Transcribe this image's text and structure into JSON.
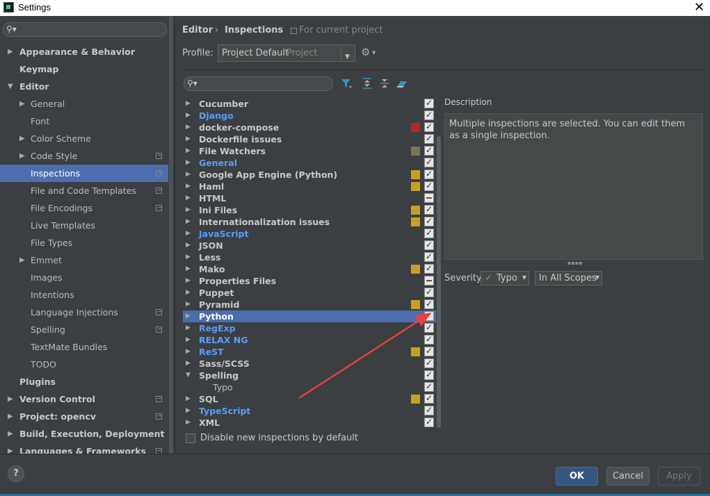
{
  "window": {
    "title": "Settings"
  },
  "left_tree": {
    "items": [
      {
        "label": "Appearance & Behavior",
        "bold": true,
        "arrow": "right",
        "indent": 0
      },
      {
        "label": "Keymap",
        "bold": true,
        "arrow": "",
        "indent": 0
      },
      {
        "label": "Editor",
        "bold": true,
        "arrow": "down",
        "indent": 0
      },
      {
        "label": "General",
        "bold": false,
        "arrow": "right",
        "indent": 1
      },
      {
        "label": "Font",
        "bold": false,
        "arrow": "",
        "indent": 1
      },
      {
        "label": "Color Scheme",
        "bold": false,
        "arrow": "right",
        "indent": 1
      },
      {
        "label": "Code Style",
        "bold": false,
        "arrow": "right",
        "indent": 1,
        "project": true
      },
      {
        "label": "Inspections",
        "bold": false,
        "arrow": "",
        "indent": 1,
        "project": true,
        "selected": true
      },
      {
        "label": "File and Code Templates",
        "bold": false,
        "arrow": "",
        "indent": 1,
        "project": true
      },
      {
        "label": "File Encodings",
        "bold": false,
        "arrow": "",
        "indent": 1,
        "project": true
      },
      {
        "label": "Live Templates",
        "bold": false,
        "arrow": "",
        "indent": 1
      },
      {
        "label": "File Types",
        "bold": false,
        "arrow": "",
        "indent": 1
      },
      {
        "label": "Emmet",
        "bold": false,
        "arrow": "right",
        "indent": 1
      },
      {
        "label": "Images",
        "bold": false,
        "arrow": "",
        "indent": 1
      },
      {
        "label": "Intentions",
        "bold": false,
        "arrow": "",
        "indent": 1
      },
      {
        "label": "Language Injections",
        "bold": false,
        "arrow": "",
        "indent": 1,
        "project": true
      },
      {
        "label": "Spelling",
        "bold": false,
        "arrow": "",
        "indent": 1,
        "project": true
      },
      {
        "label": "TextMate Bundles",
        "bold": false,
        "arrow": "",
        "indent": 1
      },
      {
        "label": "TODO",
        "bold": false,
        "arrow": "",
        "indent": 1
      },
      {
        "label": "Plugins",
        "bold": true,
        "arrow": "",
        "indent": 0
      },
      {
        "label": "Version Control",
        "bold": true,
        "arrow": "right",
        "indent": 0,
        "project": true
      },
      {
        "label": "Project: opencv",
        "bold": true,
        "arrow": "right",
        "indent": 0,
        "project": true
      },
      {
        "label": "Build, Execution, Deployment",
        "bold": true,
        "arrow": "right",
        "indent": 0
      },
      {
        "label": "Languages & Frameworks",
        "bold": true,
        "arrow": "right",
        "indent": 0,
        "project": true
      }
    ]
  },
  "breadcrumb": {
    "part1": "Editor",
    "separator": "›",
    "part2": "Inspections",
    "scope_note": "For current project"
  },
  "profile": {
    "label": "Profile:",
    "value": "Project Default",
    "type": "Project"
  },
  "inspections": [
    {
      "label": "Cucumber",
      "color": "",
      "sev": "",
      "check": "on"
    },
    {
      "label": "Django",
      "color": "blue",
      "sev": "",
      "check": "on"
    },
    {
      "label": "docker-compose",
      "color": "",
      "sev": "#b52626",
      "check": "on"
    },
    {
      "label": "Dockerfile issues",
      "color": "",
      "sev": "",
      "check": "on"
    },
    {
      "label": "File Watchers",
      "color": "",
      "sev": "#7b7560",
      "check": "on"
    },
    {
      "label": "General",
      "color": "blue",
      "sev": "",
      "check": "on"
    },
    {
      "label": "Google App Engine (Python)",
      "color": "",
      "sev": "#c9a01e",
      "check": "on"
    },
    {
      "label": "Haml",
      "color": "",
      "sev": "#c9a01e",
      "check": "on"
    },
    {
      "label": "HTML",
      "color": "",
      "sev": "",
      "check": "partial"
    },
    {
      "label": "Ini Files",
      "color": "",
      "sev": "#c9a01e",
      "check": "on"
    },
    {
      "label": "Internationalization issues",
      "color": "",
      "sev": "#c9a01e",
      "check": "on"
    },
    {
      "label": "JavaScript",
      "color": "blue",
      "sev": "",
      "check": "on"
    },
    {
      "label": "JSON",
      "color": "",
      "sev": "",
      "check": "on"
    },
    {
      "label": "Less",
      "color": "",
      "sev": "",
      "check": "on"
    },
    {
      "label": "Mako",
      "color": "",
      "sev": "#c9a01e",
      "check": "on"
    },
    {
      "label": "Properties Files",
      "color": "",
      "sev": "",
      "check": "partial"
    },
    {
      "label": "Puppet",
      "color": "",
      "sev": "",
      "check": "on"
    },
    {
      "label": "Pyramid",
      "color": "",
      "sev": "#c9a01e",
      "check": "on"
    },
    {
      "label": "Python",
      "color": "",
      "sev": "",
      "check": "on",
      "selected": true
    },
    {
      "label": "RegExp",
      "color": "blue",
      "sev": "",
      "check": "on"
    },
    {
      "label": "RELAX NG",
      "color": "blue",
      "sev": "",
      "check": "on"
    },
    {
      "label": "ReST",
      "color": "blue",
      "sev": "#c9a01e",
      "check": "on"
    },
    {
      "label": "Sass/SCSS",
      "color": "",
      "sev": "",
      "check": "on"
    },
    {
      "label": "Spelling",
      "color": "",
      "sev": "",
      "check": "on",
      "expanded": true
    },
    {
      "label": "Typo",
      "color": "",
      "sev": "",
      "check": "on",
      "child": true
    },
    {
      "label": "SQL",
      "color": "",
      "sev": "#c9a01e",
      "check": "on"
    },
    {
      "label": "TypeScript",
      "color": "blue",
      "sev": "",
      "check": "on"
    },
    {
      "label": "XML",
      "color": "",
      "sev": "",
      "check": "on"
    }
  ],
  "disable_new": {
    "label": "Disable new inspections by default"
  },
  "description": {
    "label": "Description",
    "text": "Multiple inspections are selected. You can edit them as a single inspection."
  },
  "severity": {
    "label": "Severity:",
    "value": "Typo",
    "scope": "In All Scopes"
  },
  "buttons": {
    "ok": "OK",
    "cancel": "Cancel",
    "apply": "Apply",
    "help": "?"
  },
  "colors": {
    "accent": "#4b6eaf",
    "annotation_arrow": "#e8413d"
  }
}
